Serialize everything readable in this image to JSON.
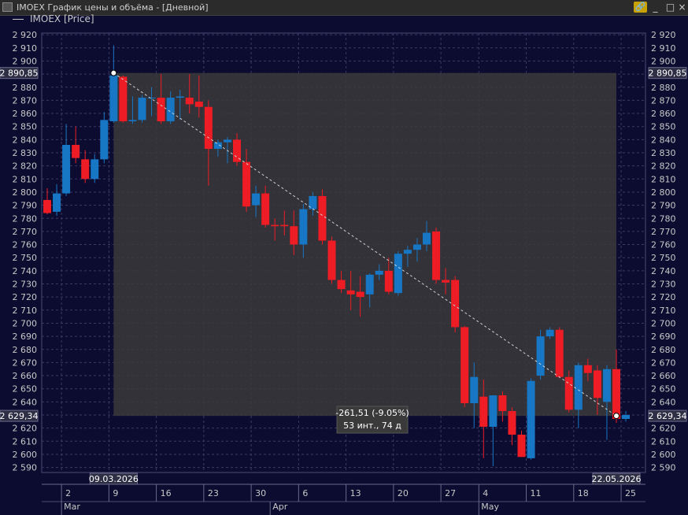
{
  "window": {
    "title": "IMOEX График цены и объёма - [Дневной]",
    "buttons": {
      "link": "🔗",
      "minimize": "_",
      "maximize": "□",
      "close": "×"
    }
  },
  "legend": {
    "label": "IMOEX [Price]"
  },
  "colors": {
    "up": "#1777c4",
    "down": "#ee1c24",
    "background": "#0c0c30",
    "grid": "#3a3a66",
    "selection": "#3a3a3a",
    "text": "#c8c8c8"
  },
  "measurement": {
    "start_label": "2 890,85",
    "end_label": "2 629,34",
    "change_text": "-261,51 (-9.05%)",
    "interval_text": "53 инт., 74 д",
    "start_date_label": "09.03.2026",
    "end_date_label": "22.05.2026"
  },
  "chart_data": {
    "type": "candlestick",
    "title": "",
    "xlabel": "",
    "ylabel": "",
    "ylim": [
      2582,
      2926
    ],
    "y_ticks": [
      2590,
      2600,
      2610,
      2620,
      2630,
      2640,
      2650,
      2660,
      2670,
      2680,
      2690,
      2700,
      2710,
      2720,
      2730,
      2740,
      2750,
      2760,
      2770,
      2780,
      2790,
      2800,
      2810,
      2820,
      2830,
      2840,
      2850,
      2860,
      2870,
      2880,
      2890,
      2900,
      2910,
      2920
    ],
    "y_tick_labels": [
      "2 590",
      "2 600",
      "2 610",
      "2 620",
      "2 630",
      "2 640",
      "2 650",
      "2 660",
      "2 670",
      "2 680",
      "2 690",
      "2 700",
      "2 710",
      "2 720",
      "2 730",
      "2 740",
      "2 750",
      "2 760",
      "2 770",
      "2 780",
      "2 790",
      "2 800",
      "2 810",
      "2 820",
      "2 830",
      "2 840",
      "2 850",
      "2 860",
      "2 870",
      "2 880",
      "2 890",
      "2 900",
      "2 910",
      "2 920"
    ],
    "x_ticks": [
      {
        "date": "2026-03-02",
        "label": "2"
      },
      {
        "date": "2026-03-09",
        "label": "9"
      },
      {
        "date": "2026-03-16",
        "label": "16"
      },
      {
        "date": "2026-03-23",
        "label": "23"
      },
      {
        "date": "2026-03-30",
        "label": "30"
      },
      {
        "date": "2026-04-06",
        "label": "6"
      },
      {
        "date": "2026-04-13",
        "label": "13"
      },
      {
        "date": "2026-04-20",
        "label": "20"
      },
      {
        "date": "2026-04-27",
        "label": "27"
      },
      {
        "date": "2026-05-04",
        "label": "4"
      },
      {
        "date": "2026-05-11",
        "label": "11"
      },
      {
        "date": "2026-05-18",
        "label": "18"
      },
      {
        "date": "2026-05-25",
        "label": "25"
      }
    ],
    "month_labels": [
      {
        "date": "2026-03-02",
        "label": "Mar"
      },
      {
        "date": "2026-04-01",
        "label": "Apr"
      },
      {
        "date": "2026-05-04",
        "label": "May"
      }
    ],
    "measure_start": {
      "date": "2026-03-09",
      "price": 2890.85
    },
    "measure_end": {
      "date": "2026-05-22",
      "price": 2629.34
    },
    "candles": [
      {
        "date": "2026-02-26",
        "open": 2794,
        "high": 2803,
        "low": 2783,
        "close": 2784
      },
      {
        "date": "2026-02-27",
        "open": 2785,
        "high": 2806,
        "low": 2782,
        "close": 2799
      },
      {
        "date": "2026-03-02",
        "open": 2799,
        "high": 2852,
        "low": 2797,
        "close": 2836
      },
      {
        "date": "2026-03-03",
        "open": 2836,
        "high": 2850,
        "low": 2822,
        "close": 2826
      },
      {
        "date": "2026-03-04",
        "open": 2825,
        "high": 2832,
        "low": 2807,
        "close": 2810
      },
      {
        "date": "2026-03-05",
        "open": 2810,
        "high": 2829,
        "low": 2807,
        "close": 2825
      },
      {
        "date": "2026-03-06",
        "open": 2825,
        "high": 2861,
        "low": 2822,
        "close": 2855
      },
      {
        "date": "2026-03-09",
        "open": 2854,
        "high": 2912,
        "low": 2853,
        "close": 2889
      },
      {
        "date": "2026-03-10",
        "open": 2888,
        "high": 2889,
        "low": 2853,
        "close": 2854
      },
      {
        "date": "2026-03-11",
        "open": 2854,
        "high": 2873,
        "low": 2852,
        "close": 2855
      },
      {
        "date": "2026-03-12",
        "open": 2855,
        "high": 2874,
        "low": 2853,
        "close": 2872
      },
      {
        "date": "2026-03-13",
        "open": 2872,
        "high": 2880,
        "low": 2858,
        "close": 2872
      },
      {
        "date": "2026-03-16",
        "open": 2872,
        "high": 2890,
        "low": 2852,
        "close": 2854
      },
      {
        "date": "2026-03-17",
        "open": 2854,
        "high": 2877,
        "low": 2852,
        "close": 2872
      },
      {
        "date": "2026-03-18",
        "open": 2872,
        "high": 2878,
        "low": 2855,
        "close": 2873
      },
      {
        "date": "2026-03-19",
        "open": 2872,
        "high": 2890,
        "low": 2860,
        "close": 2867
      },
      {
        "date": "2026-03-20",
        "open": 2869,
        "high": 2889,
        "low": 2857,
        "close": 2865
      },
      {
        "date": "2026-03-23",
        "open": 2865,
        "high": 2870,
        "low": 2805,
        "close": 2833
      },
      {
        "date": "2026-03-24",
        "open": 2833,
        "high": 2840,
        "low": 2827,
        "close": 2838
      },
      {
        "date": "2026-03-25",
        "open": 2838,
        "high": 2842,
        "low": 2822,
        "close": 2840
      },
      {
        "date": "2026-03-26",
        "open": 2840,
        "high": 2845,
        "low": 2820,
        "close": 2823
      },
      {
        "date": "2026-03-27",
        "open": 2823,
        "high": 2833,
        "low": 2785,
        "close": 2789
      },
      {
        "date": "2026-03-30",
        "open": 2790,
        "high": 2805,
        "low": 2781,
        "close": 2799
      },
      {
        "date": "2026-03-31",
        "open": 2799,
        "high": 2805,
        "low": 2773,
        "close": 2775
      },
      {
        "date": "2026-04-01",
        "open": 2775,
        "high": 2780,
        "low": 2763,
        "close": 2774
      },
      {
        "date": "2026-04-02",
        "open": 2775,
        "high": 2786,
        "low": 2767,
        "close": 2774
      },
      {
        "date": "2026-04-03",
        "open": 2774,
        "high": 2786,
        "low": 2752,
        "close": 2760
      },
      {
        "date": "2026-04-06",
        "open": 2760,
        "high": 2791,
        "low": 2750,
        "close": 2787
      },
      {
        "date": "2026-04-07",
        "open": 2787,
        "high": 2800,
        "low": 2782,
        "close": 2797
      },
      {
        "date": "2026-04-08",
        "open": 2797,
        "high": 2802,
        "low": 2760,
        "close": 2763
      },
      {
        "date": "2026-04-09",
        "open": 2763,
        "high": 2766,
        "low": 2730,
        "close": 2733
      },
      {
        "date": "2026-04-10",
        "open": 2733,
        "high": 2740,
        "low": 2723,
        "close": 2726
      },
      {
        "date": "2026-04-13",
        "open": 2725,
        "high": 2740,
        "low": 2710,
        "close": 2722
      },
      {
        "date": "2026-04-14",
        "open": 2724,
        "high": 2736,
        "low": 2705,
        "close": 2720
      },
      {
        "date": "2026-04-15",
        "open": 2722,
        "high": 2738,
        "low": 2712,
        "close": 2737
      },
      {
        "date": "2026-04-16",
        "open": 2737,
        "high": 2745,
        "low": 2733,
        "close": 2740
      },
      {
        "date": "2026-04-17",
        "open": 2740,
        "high": 2750,
        "low": 2722,
        "close": 2724
      },
      {
        "date": "2026-04-20",
        "open": 2723,
        "high": 2755,
        "low": 2721,
        "close": 2753
      },
      {
        "date": "2026-04-21",
        "open": 2753,
        "high": 2759,
        "low": 2743,
        "close": 2756
      },
      {
        "date": "2026-04-22",
        "open": 2756,
        "high": 2765,
        "low": 2747,
        "close": 2760
      },
      {
        "date": "2026-04-23",
        "open": 2760,
        "high": 2778,
        "low": 2755,
        "close": 2769
      },
      {
        "date": "2026-04-24",
        "open": 2770,
        "high": 2773,
        "low": 2730,
        "close": 2733
      },
      {
        "date": "2026-04-27",
        "open": 2733,
        "high": 2742,
        "low": 2722,
        "close": 2731
      },
      {
        "date": "2026-04-28",
        "open": 2733,
        "high": 2736,
        "low": 2693,
        "close": 2697
      },
      {
        "date": "2026-04-29",
        "open": 2697,
        "high": 2698,
        "low": 2636,
        "close": 2639
      },
      {
        "date": "2026-04-30",
        "open": 2639,
        "high": 2670,
        "low": 2620,
        "close": 2659
      },
      {
        "date": "2026-05-04",
        "open": 2644,
        "high": 2657,
        "low": 2597,
        "close": 2621
      },
      {
        "date": "2026-05-05",
        "open": 2621,
        "high": 2645,
        "low": 2591,
        "close": 2645
      },
      {
        "date": "2026-05-06",
        "open": 2645,
        "high": 2648,
        "low": 2625,
        "close": 2633
      },
      {
        "date": "2026-05-07",
        "open": 2633,
        "high": 2636,
        "low": 2607,
        "close": 2615
      },
      {
        "date": "2026-05-08",
        "open": 2615,
        "high": 2618,
        "low": 2598,
        "close": 2598
      },
      {
        "date": "2026-05-11",
        "open": 2597,
        "high": 2658,
        "low": 2596,
        "close": 2656
      },
      {
        "date": "2026-05-12",
        "open": 2660,
        "high": 2695,
        "low": 2657,
        "close": 2690
      },
      {
        "date": "2026-05-13",
        "open": 2690,
        "high": 2697,
        "low": 2688,
        "close": 2695
      },
      {
        "date": "2026-05-14",
        "open": 2695,
        "high": 2697,
        "low": 2658,
        "close": 2659
      },
      {
        "date": "2026-05-15",
        "open": 2659,
        "high": 2664,
        "low": 2632,
        "close": 2634
      },
      {
        "date": "2026-05-18",
        "open": 2634,
        "high": 2670,
        "low": 2620,
        "close": 2668
      },
      {
        "date": "2026-05-19",
        "open": 2668,
        "high": 2673,
        "low": 2656,
        "close": 2662
      },
      {
        "date": "2026-05-20",
        "open": 2664,
        "high": 2668,
        "low": 2630,
        "close": 2643
      },
      {
        "date": "2026-05-21",
        "open": 2640,
        "high": 2668,
        "low": 2611,
        "close": 2665
      },
      {
        "date": "2026-05-22",
        "open": 2665,
        "high": 2680,
        "low": 2624,
        "close": 2627
      },
      {
        "date": "2026-05-25",
        "open": 2627,
        "high": 2633,
        "low": 2625,
        "close": 2630
      }
    ]
  }
}
